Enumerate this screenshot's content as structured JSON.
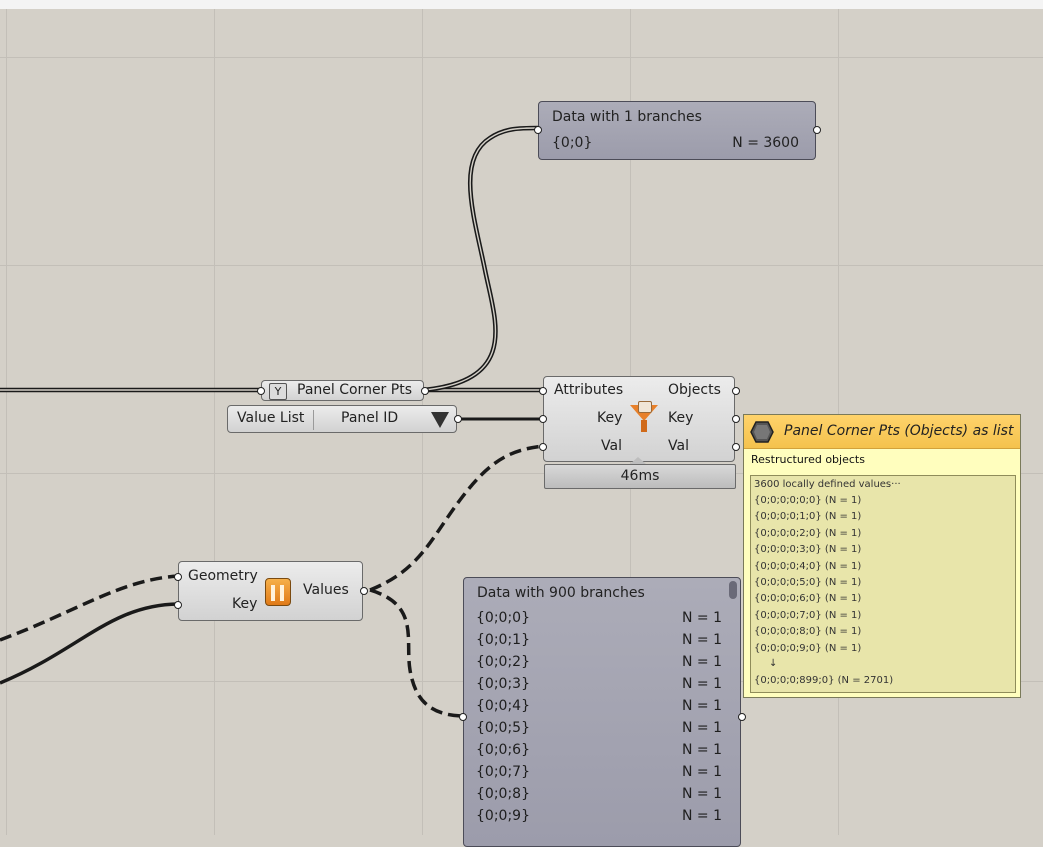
{
  "panel_top": {
    "title": "Data with 1 branches",
    "path": "{0;0}",
    "count": "N = 3600"
  },
  "panel_corner": {
    "label": "Panel Corner Pts"
  },
  "value_list": {
    "label": "Value List",
    "value": "Panel ID"
  },
  "sort_component": {
    "inputs": [
      "Attributes",
      "Key",
      "Val"
    ],
    "outputs": [
      "Objects",
      "Key",
      "Val"
    ],
    "timing": "46ms"
  },
  "geometry_component": {
    "inputs": [
      "Geometry",
      "Key"
    ],
    "outputs": [
      "Values"
    ]
  },
  "panel_900": {
    "title": "Data with 900 branches",
    "rows": [
      {
        "path": "{0;0;0}",
        "count": "N = 1"
      },
      {
        "path": "{0;0;1}",
        "count": "N = 1"
      },
      {
        "path": "{0;0;2}",
        "count": "N = 1"
      },
      {
        "path": "{0;0;3}",
        "count": "N = 1"
      },
      {
        "path": "{0;0;4}",
        "count": "N = 1"
      },
      {
        "path": "{0;0;5}",
        "count": "N = 1"
      },
      {
        "path": "{0;0;6}",
        "count": "N = 1"
      },
      {
        "path": "{0;0;7}",
        "count": "N = 1"
      },
      {
        "path": "{0;0;8}",
        "count": "N = 1"
      },
      {
        "path": "{0;0;9}",
        "count": "N = 1"
      }
    ]
  },
  "tooltip": {
    "title": "Panel Corner Pts (Objects) as list",
    "subtitle": "Restructured objects",
    "summary": "3600 locally defined values···",
    "lines": [
      "{0;0;0;0;0;0} (N = 1)",
      "{0;0;0;0;1;0} (N = 1)",
      "{0;0;0;0;2;0} (N = 1)",
      "{0;0;0;0;3;0} (N = 1)",
      "{0;0;0;0;4;0} (N = 1)",
      "{0;0;0;0;5;0} (N = 1)",
      "{0;0;0;0;6;0} (N = 1)",
      "{0;0;0;0;7;0} (N = 1)",
      "{0;0;0;0;8;0} (N = 1)",
      "{0;0;0;0;9;0} (N = 1)"
    ],
    "ellipsis": "↓",
    "last": "{0;0;0;0;899;0} (N = 2701)"
  },
  "colors": {
    "canvas": "#d4d0c8",
    "panel": "#a4a4b2",
    "component": "#dedede",
    "tooltip_header": "#f6c552",
    "tooltip_body": "#fffebe"
  }
}
